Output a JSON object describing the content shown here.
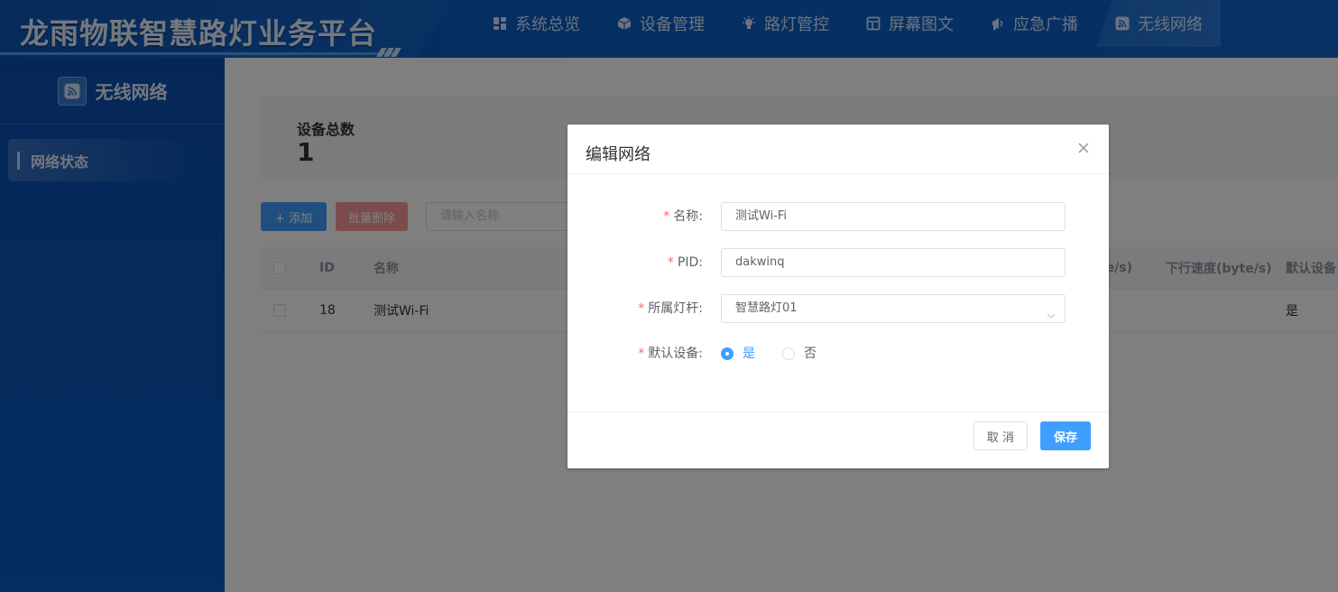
{
  "app": {
    "title": "龙雨物联智慧路灯业务平台"
  },
  "nav": {
    "items": [
      {
        "label": "系统总览",
        "icon": "dashboard-icon"
      },
      {
        "label": "设备管理",
        "icon": "box-icon"
      },
      {
        "label": "路灯管控",
        "icon": "streetlight-icon"
      },
      {
        "label": "屏幕图文",
        "icon": "screen-icon"
      },
      {
        "label": "应急广播",
        "icon": "megaphone-icon"
      },
      {
        "label": "无线网络",
        "icon": "wifi-icon",
        "active": true
      }
    ]
  },
  "sidebar": {
    "title": "无线网络",
    "items": [
      {
        "label": "网络状态",
        "active": true
      }
    ]
  },
  "summary": {
    "label": "设备总数",
    "value": "1"
  },
  "toolbar": {
    "add_label": "+ 添加",
    "batch_delete_label": "批量删除",
    "search_placeholder": "请输入名称"
  },
  "table": {
    "columns": [
      "ID",
      "名称",
      "te/s)",
      "下行速度(byte/s)",
      "默认设备"
    ],
    "rows": [
      {
        "id": "18",
        "name": "测试Wi-Fi",
        "default": "是"
      }
    ]
  },
  "dialog": {
    "title": "编辑网络",
    "fields": {
      "name": {
        "label": "名称:",
        "value": "测试Wi-Fi"
      },
      "pid": {
        "label": "PID:",
        "value": "dakwinq"
      },
      "pole": {
        "label": "所属灯杆:",
        "value": "智慧路灯01"
      },
      "default": {
        "label": "默认设备:",
        "yes": "是",
        "no": "否",
        "selected": "是"
      }
    },
    "cancel_label": "取 消",
    "save_label": "保存"
  },
  "colors": {
    "primary": "#409eff",
    "danger_light": "#f89898",
    "header_blue": "#0b5fc6",
    "required": "#f56c6c"
  }
}
